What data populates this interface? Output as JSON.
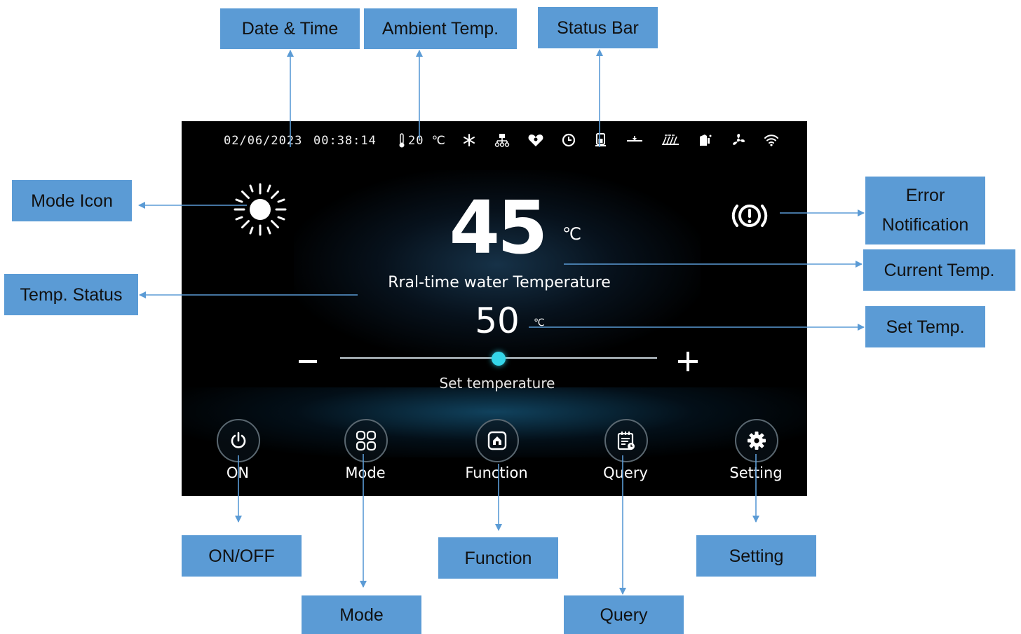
{
  "status_bar": {
    "date": "02/06/2023",
    "time": "00:38:14",
    "ambient_temp": "20 ℃",
    "icons": [
      "snowflake-icon",
      "tank-network-icon",
      "heart-wings-icon",
      "clock-icon",
      "water-tank-icon",
      "pipe-valve-icon",
      "heater-icon",
      "fuel-tank-icon",
      "fan-icon",
      "wifi-icon"
    ]
  },
  "main": {
    "mode_icon": "sun-icon",
    "error_icon": "error-alert-icon",
    "current_temp": "45",
    "current_unit": "℃",
    "current_label": "Rral-time water Temperature",
    "set_temp": "50",
    "set_unit": "℃",
    "set_label": "Set temperature",
    "slider_level": 0.5
  },
  "bottom_buttons": [
    {
      "label": "ON",
      "icon": "power-icon"
    },
    {
      "label": "Mode",
      "icon": "grid-icon"
    },
    {
      "label": "Function",
      "icon": "home-icon"
    },
    {
      "label": "Query",
      "icon": "calendar-icon"
    },
    {
      "label": "Setting",
      "icon": "gear-icon"
    }
  ],
  "callouts": {
    "date_time": "Date & Time",
    "ambient_temp": "Ambient Temp.",
    "status_bar": "Status Bar",
    "mode_icon": "Mode Icon",
    "error_notification_line1": "Error",
    "error_notification_line2": "Notification",
    "current_temp": "Current Temp.",
    "temp_status": "Temp. Status",
    "set_temp": "Set Temp.",
    "on_off": "ON/OFF",
    "mode": "Mode",
    "function": "Function",
    "query": "Query",
    "setting": "Setting"
  },
  "colors": {
    "callout_bg": "#5b9bd5",
    "arrow": "#5b9bd5",
    "screen_bg": "#000000",
    "slider_thumb": "#35d6e9"
  }
}
